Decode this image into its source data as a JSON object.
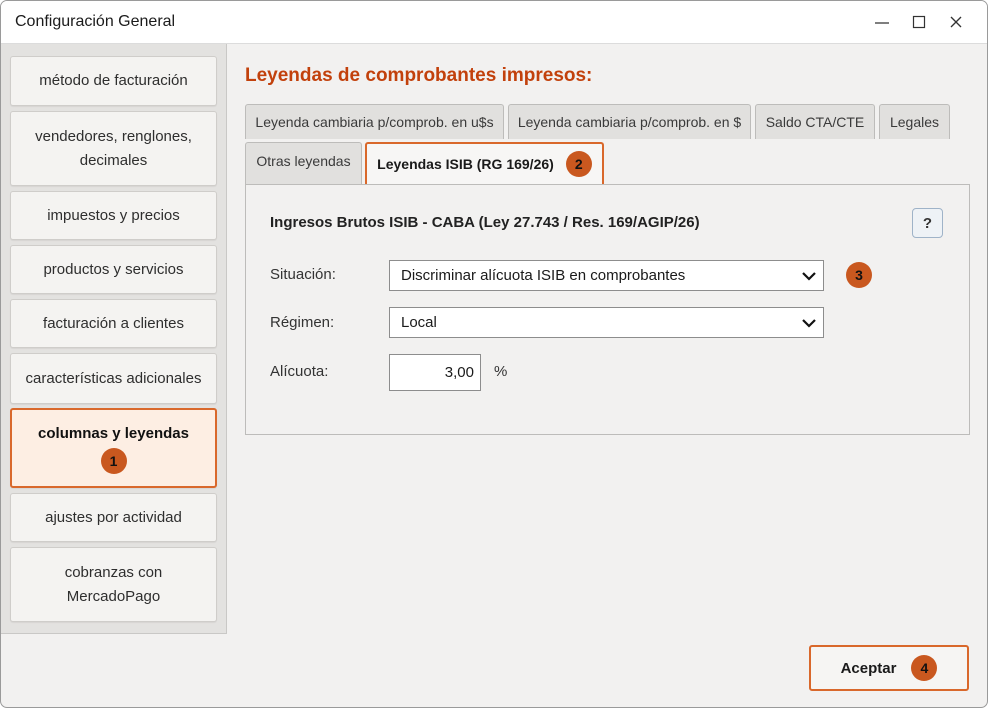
{
  "window": {
    "title": "Configuración General"
  },
  "sidebar": {
    "items": [
      {
        "label": "método de facturación"
      },
      {
        "label": "vendedores, renglones,",
        "label2": "decimales"
      },
      {
        "label": "impuestos y precios"
      },
      {
        "label": "productos y servicios"
      },
      {
        "label": "facturación a clientes"
      },
      {
        "label": "características adicionales"
      },
      {
        "label": "columnas y leyendas",
        "badge": "1",
        "active": true
      },
      {
        "label": "ajustes por actividad"
      },
      {
        "label": "cobranzas con",
        "label2": "MercadoPago"
      }
    ]
  },
  "main": {
    "title": "Leyendas de comprobantes impresos:",
    "tabs": [
      {
        "label": "Leyenda cambiaria p/comprob. en u$s"
      },
      {
        "label": "Leyenda cambiaria p/comprob. en $"
      },
      {
        "label": "Saldo CTA/CTE"
      },
      {
        "label": "Legales"
      },
      {
        "label": "Otras leyendas"
      },
      {
        "label": "Leyendas ISIB (RG 169/26)",
        "badge": "2",
        "active": true
      }
    ],
    "panel": {
      "heading": "Ingresos Brutos ISIB - CABA (Ley 27.743 / Res. 169/AGIP/26)",
      "help_label": "?",
      "situacion_label": "Situación:",
      "situacion_value": "Discriminar alícuota ISIB en comprobantes",
      "situacion_badge": "3",
      "regimen_label": "Régimen:",
      "regimen_value": "Local",
      "alicuota_label": "Alícuota:",
      "alicuota_value": "3,00",
      "percent_sign": "%"
    }
  },
  "footer": {
    "accept_label": "Aceptar",
    "accept_badge": "4"
  },
  "colors": {
    "accent": "#d9682b",
    "badge": "#c9581f",
    "title": "#c2410c"
  },
  "icons": [
    "minimize-icon",
    "maximize-icon",
    "close-icon",
    "chevron-down-icon"
  ]
}
